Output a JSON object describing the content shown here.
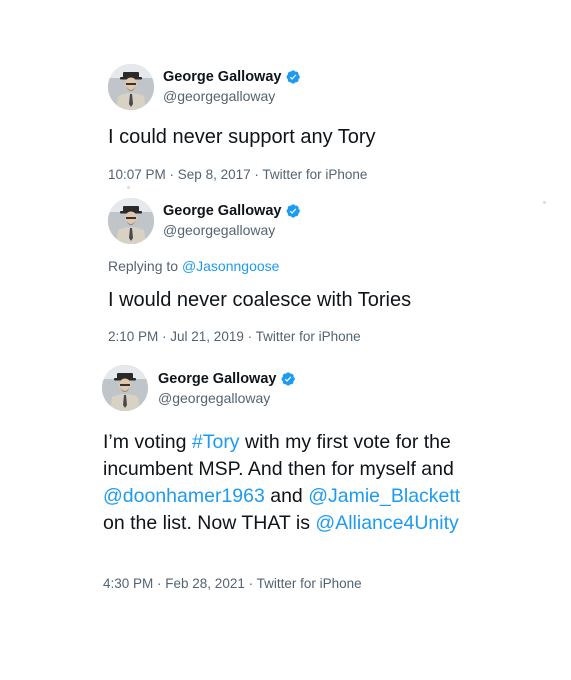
{
  "tweets": [
    {
      "author_name": "George Galloway",
      "handle": "@georgegalloway",
      "text": "I could never support any Tory",
      "time": "10:07 PM",
      "date": "Sep 8, 2017",
      "source": "Twitter for iPhone"
    },
    {
      "author_name": "George Galloway",
      "handle": "@georgegalloway",
      "replying_prefix": "Replying to ",
      "replying_to": "@Jasonngoose",
      "text": "I would never coalesce with Tories",
      "time": "2:10 PM",
      "date": "Jul 21, 2019",
      "source": "Twitter for iPhone"
    },
    {
      "author_name": "George Galloway",
      "handle": "@georgegalloway",
      "text_parts": {
        "p1": "I’m voting ",
        "hashtag": "#Tory",
        "p2": " with my first vote for the incumbent MSP. And then for myself and ",
        "mention1": "@doonhamer1963",
        "p3": " and ",
        "mention2": "@Jamie_Blackett",
        "p4": " on the list. Now THAT is ",
        "mention3": "@Alliance4Unity"
      },
      "time": "4:30 PM",
      "date": "Feb 28, 2021",
      "source": "Twitter for iPhone"
    }
  ],
  "separator": " · ",
  "colors": {
    "text": "#0f1419",
    "secondary": "#536471",
    "link": "#1d9bf0",
    "verified": "#1d9bf0"
  },
  "icons": {
    "verified": "verified-badge-icon"
  }
}
